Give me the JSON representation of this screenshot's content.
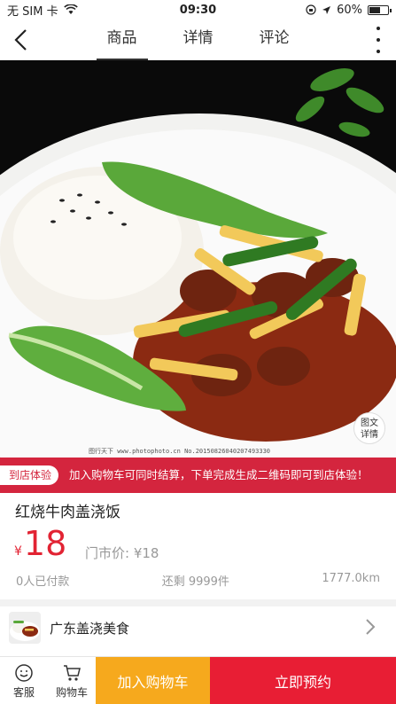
{
  "status_bar": {
    "carrier": "无 SIM 卡",
    "time": "09:30",
    "battery_text": "60%",
    "battery_level": 0.6
  },
  "nav": {
    "tabs": [
      {
        "label": "商品"
      },
      {
        "label": "详情"
      },
      {
        "label": "评论"
      }
    ]
  },
  "hero": {
    "detail_badge_line1": "图文",
    "detail_badge_line2": "详情",
    "watermark": "图行天下 www.photophoto.cn  No.20150826040207493330"
  },
  "promo": {
    "tag": "到店体验",
    "text": "加入购物车可同时结算，下单完成生成二维码即可到店体验！"
  },
  "product": {
    "title": "红烧牛肉盖浇饭",
    "currency": "¥",
    "price": "18",
    "original_price": "门市价: ¥18",
    "sold": "0人已付款",
    "stock": "还剩 9999件",
    "distance": "1777.0km"
  },
  "shop": {
    "name": "广东盖浇美食"
  },
  "bottom_bar": {
    "service_label": "客服",
    "cart_label": "购物车",
    "add_to_cart": "加入购物车",
    "reserve": "立即预约"
  },
  "colors": {
    "accent_red": "#e81e34",
    "accent_orange": "#f6a91d",
    "price_red": "#e22333"
  },
  "icons": [
    "back-arrow-icon",
    "more-vertical-icon",
    "chevron-right-icon",
    "smile-icon",
    "cart-icon",
    "signal-wifi-icon",
    "location-icon",
    "lock-rotation-icon"
  ]
}
